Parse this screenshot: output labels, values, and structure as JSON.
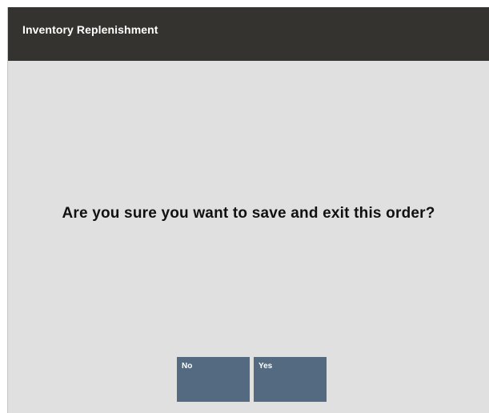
{
  "window": {
    "title": "Inventory Replenishment"
  },
  "dialog": {
    "message": "Are you sure you want to save and exit this order?"
  },
  "buttons": {
    "no_label": "No",
    "yes_label": "Yes"
  },
  "colors": {
    "title_bar": "#35332f",
    "background": "#e0e0e0",
    "button": "#546a80"
  }
}
